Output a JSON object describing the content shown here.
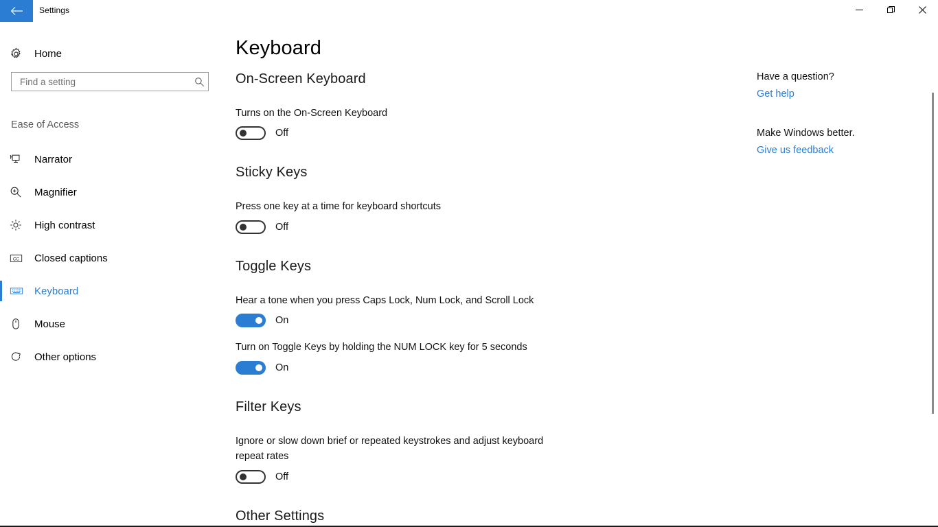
{
  "window": {
    "title": "Settings",
    "back_icon": "back-arrow-icon",
    "accent_color": "#2b7cd3",
    "controls": [
      {
        "name": "minimize",
        "icon": "minimize-icon"
      },
      {
        "name": "restore",
        "icon": "restore-icon"
      },
      {
        "name": "close",
        "icon": "close-icon"
      }
    ]
  },
  "sidebar": {
    "home": {
      "label": "Home",
      "icon": "gear-icon"
    },
    "search": {
      "placeholder": "Find a setting",
      "value": "",
      "icon": "search-icon"
    },
    "group_label": "Ease of Access",
    "items": [
      {
        "label": "Narrator",
        "icon": "narrator-icon",
        "selected": false
      },
      {
        "label": "Magnifier",
        "icon": "magnifier-icon",
        "selected": false
      },
      {
        "label": "High contrast",
        "icon": "brightness-icon",
        "selected": false
      },
      {
        "label": "Closed captions",
        "icon": "closed-captions-icon",
        "selected": false
      },
      {
        "label": "Keyboard",
        "icon": "keyboard-icon",
        "selected": true
      },
      {
        "label": "Mouse",
        "icon": "mouse-icon",
        "selected": false
      },
      {
        "label": "Other options",
        "icon": "other-options-icon",
        "selected": false
      }
    ]
  },
  "main": {
    "page_title": "Keyboard",
    "sections": [
      {
        "heading": "On-Screen Keyboard",
        "settings": [
          {
            "description": "Turns on the On-Screen Keyboard",
            "state_label": "Off",
            "state": "off"
          }
        ]
      },
      {
        "heading": "Sticky Keys",
        "settings": [
          {
            "description": "Press one key at a time for keyboard shortcuts",
            "state_label": "Off",
            "state": "off"
          }
        ]
      },
      {
        "heading": "Toggle Keys",
        "settings": [
          {
            "description": "Hear a tone when you press Caps Lock, Num Lock, and Scroll Lock",
            "state_label": "On",
            "state": "on"
          },
          {
            "description": "Turn on Toggle Keys by holding the NUM LOCK key for 5 seconds",
            "state_label": "On",
            "state": "on"
          }
        ]
      },
      {
        "heading": "Filter Keys",
        "settings": [
          {
            "description": "Ignore or slow down brief or repeated keystrokes and adjust keyboard repeat rates",
            "state_label": "Off",
            "state": "off"
          }
        ]
      },
      {
        "heading": "Other Settings",
        "settings": []
      }
    ]
  },
  "help": {
    "question_heading": "Have a question?",
    "question_link": "Get help",
    "feedback_heading": "Make Windows better.",
    "feedback_link": "Give us feedback"
  }
}
